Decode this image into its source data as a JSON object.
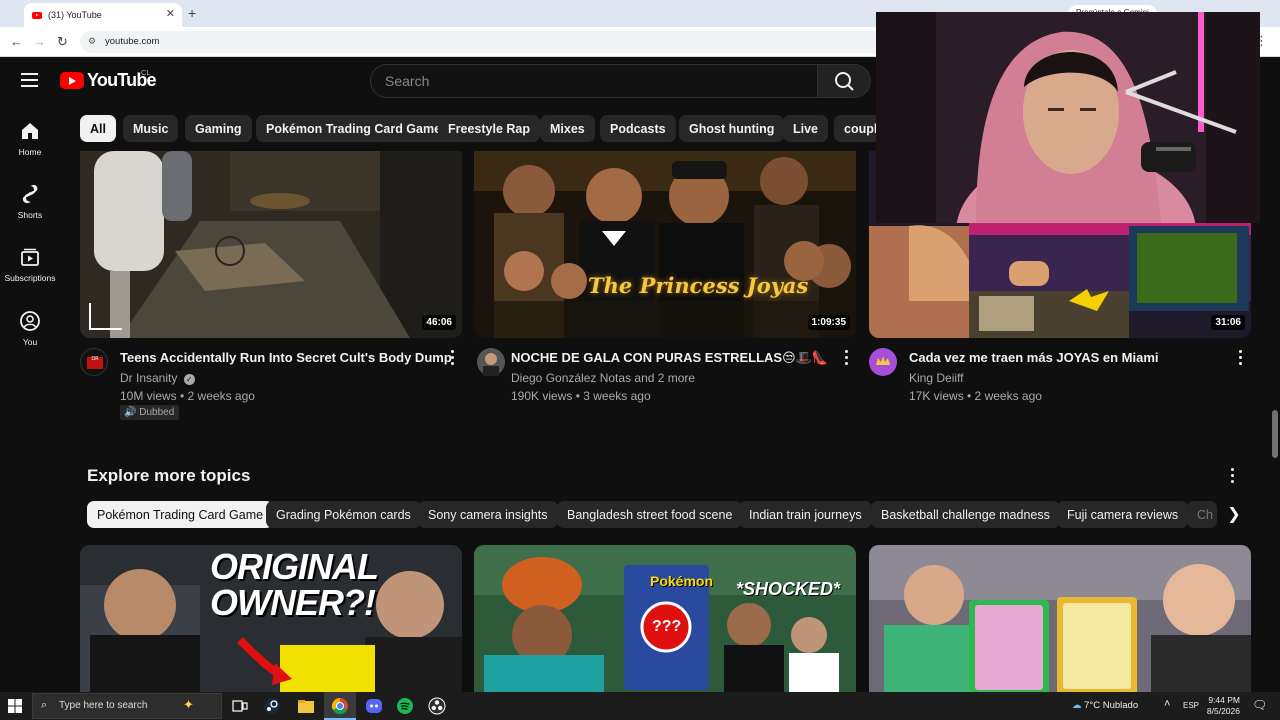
{
  "browser": {
    "tab_title": "(31) YouTube",
    "url": "youtube.com",
    "gemini_hint": "Pregúntale a Gemini"
  },
  "header": {
    "logo_text": "YouTube",
    "country": "CL",
    "search_placeholder": "Search"
  },
  "chips": [
    "All",
    "Music",
    "Gaming",
    "Pokémon Trading Card Game",
    "Freestyle Rap",
    "Mixes",
    "Podcasts",
    "Ghost hunting",
    "Live",
    "couple"
  ],
  "sidebar": [
    {
      "label": "Home",
      "icon": "home-icon"
    },
    {
      "label": "Shorts",
      "icon": "shorts-icon"
    },
    {
      "label": "Subscriptions",
      "icon": "subscriptions-icon"
    },
    {
      "label": "You",
      "icon": "you-icon"
    }
  ],
  "videos": [
    {
      "title": "Teens Accidentally Run Into Secret Cult's Body Dump",
      "channel": "Dr Insanity",
      "verified": true,
      "meta": "10M views • 2 weeks ago",
      "duration": "46:06",
      "badge": "Dubbed"
    },
    {
      "title": "NOCHE DE GALA CON PURAS ESTRELLAS😒🎩👠",
      "channel": "Diego González Notas and 2 more",
      "meta": "190K views • 3 weeks ago",
      "duration": "1:09:35",
      "thumb_text": "The Princess Joyas"
    },
    {
      "title": "Cada vez me traen más JOYAS en Miami",
      "channel": "King Deiiff",
      "meta": "17K views • 2 weeks ago",
      "duration": "31:06"
    }
  ],
  "explore": {
    "heading": "Explore more topics",
    "topics": [
      "Pokémon Trading Card Game",
      "Grading Pokémon cards",
      "Sony camera insights",
      "Bangladesh street food scene",
      "Indian train journeys",
      "Basketball challenge madness",
      "Fuji camera reviews",
      "Ch"
    ]
  },
  "thumbs2": {
    "t1_text": "ORIGINAL OWNER?!",
    "t2_text": "*SHOCKED*",
    "t2_card": "???"
  },
  "taskbar": {
    "search_placeholder": "Type here to search",
    "weather": "7°C  Nublado",
    "lang": "ESP",
    "time": "9:44 PM",
    "date": "8/5/2026"
  },
  "colors": {
    "background": "#0f0f0f",
    "chip_bg": "#272727",
    "youtube_red": "#ff0000",
    "meta_text": "#aaaaaa"
  }
}
